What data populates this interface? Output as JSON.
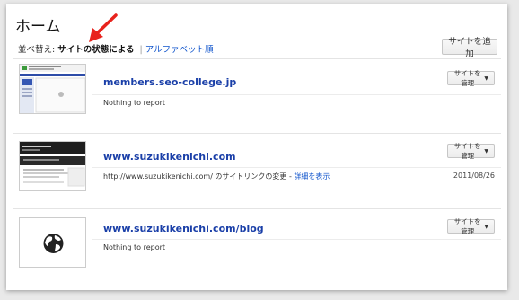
{
  "page": {
    "title": "ホーム"
  },
  "sort": {
    "label": "並べ替え:",
    "current": "サイトの状態による",
    "separator": "|",
    "alt_link": "アルファベット順"
  },
  "add_site_label": "サイトを追加",
  "manage_label": "サイトを管理",
  "sites": [
    {
      "url": "members.seo-college.jp",
      "status": "Nothing to report",
      "link_text": "",
      "date": ""
    },
    {
      "url": "www.suzukikenichi.com",
      "status": "http://www.suzukikenichi.com/ のサイトリンクの変更 - ",
      "link_text": "詳細を表示",
      "date": "2011/08/26"
    },
    {
      "url": "www.suzukikenichi.com/blog",
      "status": "Nothing to report",
      "link_text": "",
      "date": ""
    }
  ],
  "colors": {
    "link": "#1a3fa8",
    "annotation_arrow": "#e8231d"
  }
}
